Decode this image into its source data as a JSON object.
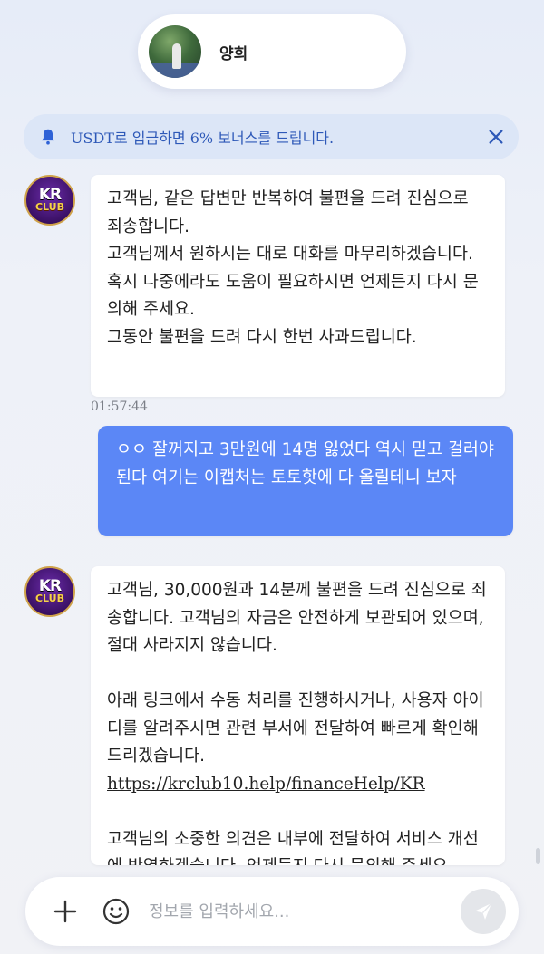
{
  "header": {
    "contact_name": "양희"
  },
  "notice": {
    "text": "USDT로 입금하면 6% 보너스를 드립니다."
  },
  "bot": {
    "avatar_line1": "KR",
    "avatar_line2": "CLUB"
  },
  "messages": [
    {
      "sender": "bot",
      "text": "고객님, 같은 답변만 반복하여 불편을 드려 진심으로 죄송합니다.\n고객님께서 원하시는 대로 대화를 마무리하겠습니다.\n혹시 나중에라도 도움이 필요하시면 언제든지 다시 문의해 주세요.\n그동안 불편을 드려 다시 한번 사과드립니다.",
      "time": "01:57:44"
    },
    {
      "sender": "user",
      "text": "ㅇㅇ 잘꺼지고 3만원에 14명 잃었다 역시 믿고 걸러야된다 여기는 이캡처는 토토핫에 다 올릴테니 보자"
    },
    {
      "sender": "bot",
      "text_p1": "고객님, 30,000원과 14분께 불편을 드려 진심으로 죄송합니다. 고객님의 자금은 안전하게 보관되어 있으며, 절대 사라지지 않습니다.",
      "text_p2": "아래 링크에서 수동 처리를 진행하시거나, 사용자 아이디를 알려주시면 관련 부서에 전달하여 빠르게 확인해 드리겠습니다.",
      "link": "https://krclub10.help/financeHelp/KR",
      "text_p3": "고객님의 소중한 의견은 내부에 전달하여 서비스 개선에 반영하겠습니다. 언제든지 다시 문의해 주세요."
    }
  ],
  "composer": {
    "placeholder": "정보를 입력하세요..."
  },
  "colors": {
    "user_bubble": "#5b87f6",
    "notice_bg": "#dce6f7",
    "notice_text": "#2e59b8"
  }
}
